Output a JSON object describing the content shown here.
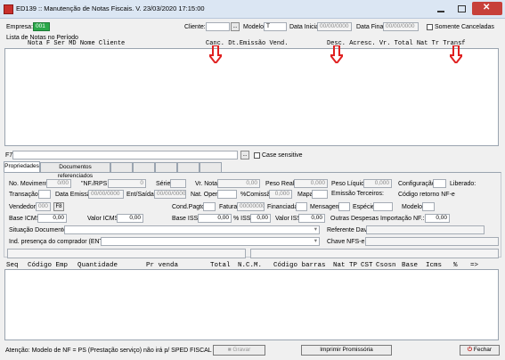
{
  "window": {
    "title": "ED139 :: Manutenção de Notas Fiscais. V. 23/03/2020 17:15:00"
  },
  "filters": {
    "empresa_label": "Empresa:",
    "empresa_value": "001",
    "cliente_label": "Cliente:",
    "cliente_value": "",
    "modelo_label": "Modelo:",
    "modelo_value": "T",
    "data_inicial_label": "Data Inicial:",
    "data_inicial_value": "00/00/0000",
    "data_final_label": "Data Final:",
    "data_final_value": "00/00/0000",
    "somente_canceladas_label": "Somente Canceladas"
  },
  "notes_list": {
    "label": "Lista de Notas no Período",
    "columns": [
      "Nota",
      "F",
      "Ser",
      "MD",
      "Nome Cliente",
      "Canc.",
      "Dt.Emissão",
      "Vend.",
      "Desc.",
      "Acresc.",
      "Vr. Total",
      "Nat",
      "Tr",
      "Transf"
    ]
  },
  "search": {
    "label": "F7",
    "value": "",
    "case_label": "Case sensitive"
  },
  "tabs": [
    "Propriedades",
    "Documentos referenciados",
    "",
    "",
    "",
    "",
    ""
  ],
  "props": {
    "no_mov_label": "No. Movimento:",
    "no_mov_value": "0/00",
    "nf_rps_label": "\"NF./RPS:",
    "nf_rps_value": "0",
    "serie_label": "Série:",
    "vr_nota_label": "Vr. Nota:",
    "vr_nota_value": "0,00",
    "peso_real_label": "Peso Real:",
    "peso_real_value": "0,000",
    "peso_liq_label": "Peso Líquido:",
    "peso_liq_value": "0,000",
    "config_label": "Configuração",
    "liberado_label": "Liberado:",
    "transacao_label": "Transação:",
    "data_emissao_label": "Data Emissão:",
    "data_emissao_value": "00/00/0000",
    "ent_saida_label": "Ent/Saída:",
    "ent_saida_value": "00/00/0000",
    "nat_oper_label": "Nat. Oper.",
    "comissao_label": "%Comissão:",
    "comissao_value": "0,000",
    "mapa_label": "Mapa:",
    "emissao_terceiros_label": "Emissão Terceiros:",
    "codigo_retorno_label": "Código retorno NF-e",
    "vendedor_label": "Vendedor:",
    "vendedor_value": "000",
    "f8_label": "F8",
    "cond_pagto_label": "Cond.Pagto.:",
    "fatura_label": "Fatura:",
    "fatura_value": "00000000",
    "financiada_label": "Financiada:",
    "mensagem_label": "Mensagem:",
    "especie_label": "Espécie",
    "modelo_label": "Modelo:",
    "base_icms_label": "Base ICMS:",
    "base_icms_value": "0,00",
    "valor_icms_label": "Valor ICMS:",
    "valor_icms_value": "0,00",
    "base_iss_label": "Base ISS:",
    "base_iss_value": "0,00",
    "pct_iss_label": "% ISS:",
    "pct_iss_value": "0,00",
    "valor_iss_label": "Valor ISS:",
    "valor_iss_value": "0,00",
    "outras_label": "Outras Despesas Importação NF.:",
    "outras_value": "0,00",
    "situacao_label": "Situação Documento:",
    "referente_label": "Referente Dav.:",
    "ind_presenca_label": "Ind. presença do comprador (ENTER):",
    "chave_label": "Chave NFS-e :"
  },
  "items_list": {
    "columns": [
      "Seq",
      "Código Emp",
      "Quantidade",
      "Pr venda",
      "Total",
      "N.C.M.",
      "Código barras",
      "Nat",
      "TP",
      "CST",
      "Csosn",
      "Base",
      "Icms",
      "%",
      "=>"
    ]
  },
  "footer": {
    "note": "Atenção: Modelo de NF = PS (Prestação serviço) não irá p/ SPED FISCAL",
    "gravar_label": "Gravar",
    "imprimir_label": "Imprimir Promissória",
    "fechar_label": "Fechar"
  },
  "colors": {
    "annotation_arrow": "#e02020",
    "empresa_green": "#2ba84a"
  }
}
